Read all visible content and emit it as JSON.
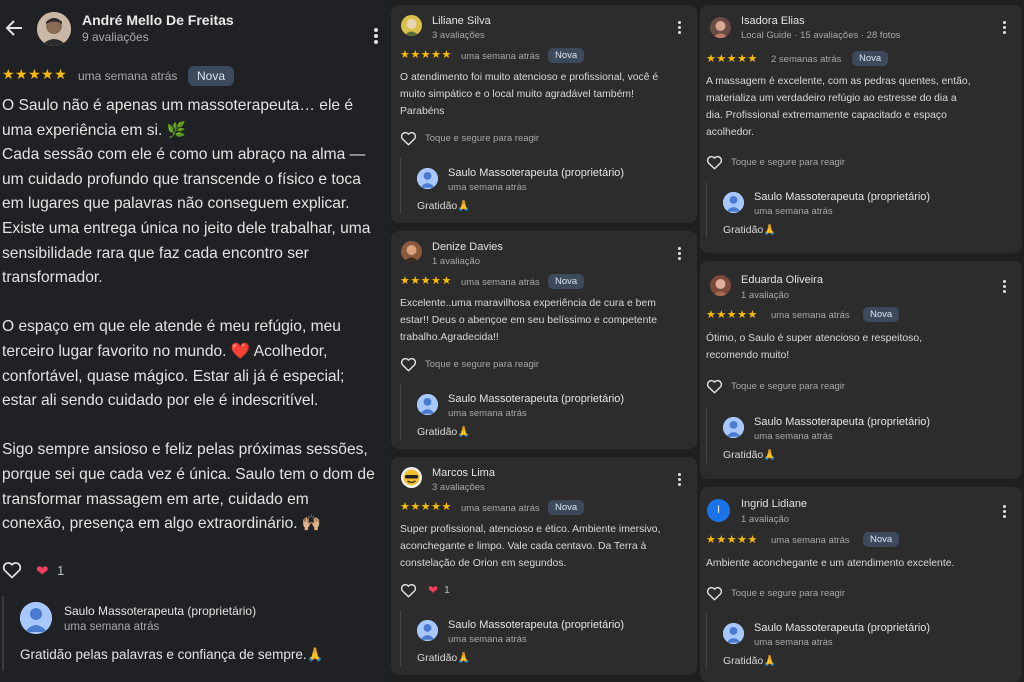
{
  "colors": {
    "background": "#1f1f1f",
    "card": "#2c2c2c",
    "star": "#fbbc04",
    "badge": "#3c4a5c",
    "heart": "#ef3f5d",
    "owner_avatar": "#a8c7fa"
  },
  "main_review": {
    "name": "André Mello De Freitas",
    "sub": "9 avaliações",
    "stars": "★★★★★",
    "when": "uma semana atrás",
    "badge": "Nova",
    "text": "O Saulo não é apenas um massoterapeuta… ele é\numa experiência em si. 🌿\nCada sessão com ele é como um abraço na alma —\num cuidado profundo que transcende o físico e toca\nem lugares que palavras não conseguem explicar.\nExiste uma entrega única no jeito dele trabalhar, uma\nsensibilidade rara que faz cada encontro ser\ntransformador.\n\nO espaço em que ele atende é meu refúgio, meu\nterceiro lugar favorito no mundo. ❤️ Acolhedor,\nconfortável, quase mágico. Estar ali já é especial;\nestar ali sendo cuidado por ele é indescritível.\n\nSigo sempre ansioso e feliz pelas próximas sessões,\nporque sei que cada vez é única. Saulo tem o dom de\ntransformar massagem em arte, cuidado em\nconexão, presença em algo extraordinário. 🙌🏼",
    "reaction_count": "1",
    "owner": {
      "name": "Saulo Massoterapeuta (proprietário)",
      "when": "uma semana atrás",
      "reply": "Gratidão pelas palavras e confiança de sempre.🙏"
    }
  },
  "cards": [
    {
      "name": "Liliane Silva",
      "sub": "3 avaliações",
      "stars": "★★★★★",
      "when": "uma semana atrás",
      "badge": "Nova",
      "body": "O atendimento foi muito atencioso e profissional, você é\nmuito simpático e o local muito agradável também!\nParabéns",
      "react_label": "Toque e segure para reagir",
      "owner": {
        "name": "Saulo Massoterapeuta (proprietário)",
        "when": "uma semana atrás",
        "reply": "Gratidão🙏"
      }
    },
    {
      "name": "Denize Davies",
      "sub": "1 avaliação",
      "stars": "★★★★★",
      "when": "uma semana atrás",
      "badge": "Nova",
      "body": "Excelente..uma maravilhosa experiência de cura e bem\nestar!! Deus o abençoe em seu belíssimo e competente\ntrabalho.Agradecida!!",
      "react_label": "Toque e segure para reagir",
      "owner": {
        "name": "Saulo Massoterapeuta (proprietário)",
        "when": "uma semana atrás",
        "reply": "Gratidão🙏"
      }
    },
    {
      "name": "Marcos Lima",
      "sub": "3 avaliações",
      "stars": "★★★★★",
      "when": "uma semana atrás",
      "badge": "Nova",
      "body": "Super profissional, atencioso e ético. Ambiente imersivo,\naconchegante e limpo. Vale cada centavo. Da Terra à\nconstelação de Orion em segundos.",
      "reaction_count": "1",
      "owner": {
        "name": "Saulo Massoterapeuta (proprietário)",
        "when": "uma semana atrás",
        "reply": "Gratidão🙏"
      }
    },
    {
      "name": "Isadora Elias",
      "sub": "Local Guide · 15 avaliações · 28 fotos",
      "stars": "★★★★★",
      "when": "2 semanas atrás",
      "badge": "Nova",
      "body": "A massagem é excelente, com as pedras quentes, então,\nmaterializa um verdadeiro refúgio ao estresse do dia a\ndia. Profissional extremamente capacitado e espaço\nacolhedor.",
      "react_label": "Toque e segure para reagir",
      "owner": {
        "name": "Saulo Massoterapeuta (proprietário)",
        "when": "uma semana atrás",
        "reply": "Gratidão🙏"
      }
    },
    {
      "name": "Eduarda Oliveira",
      "sub": "1 avaliação",
      "stars": "★★★★★",
      "when": "uma semana atrás",
      "badge": "Nova",
      "body": "Ótimo, o Saulo é super atencioso e respeitoso,\nrecomendo muito!",
      "react_label": "Toque e segure para reagir",
      "owner": {
        "name": "Saulo Massoterapeuta (proprietário)",
        "when": "uma semana atrás",
        "reply": "Gratidão🙏"
      }
    },
    {
      "name": "Ingrid Lidiane",
      "sub": "1 avaliação",
      "avatar_letter": "I",
      "stars": "★★★★★",
      "when": "uma semana atrás",
      "badge": "Nova",
      "body": "Ambiente aconchegante e um atendimento excelente.",
      "react_label": "Toque e segure para reagir",
      "owner": {
        "name": "Saulo Massoterapeuta (proprietário)",
        "when": "uma semana atrás",
        "reply": "Gratidão🙏"
      }
    }
  ]
}
